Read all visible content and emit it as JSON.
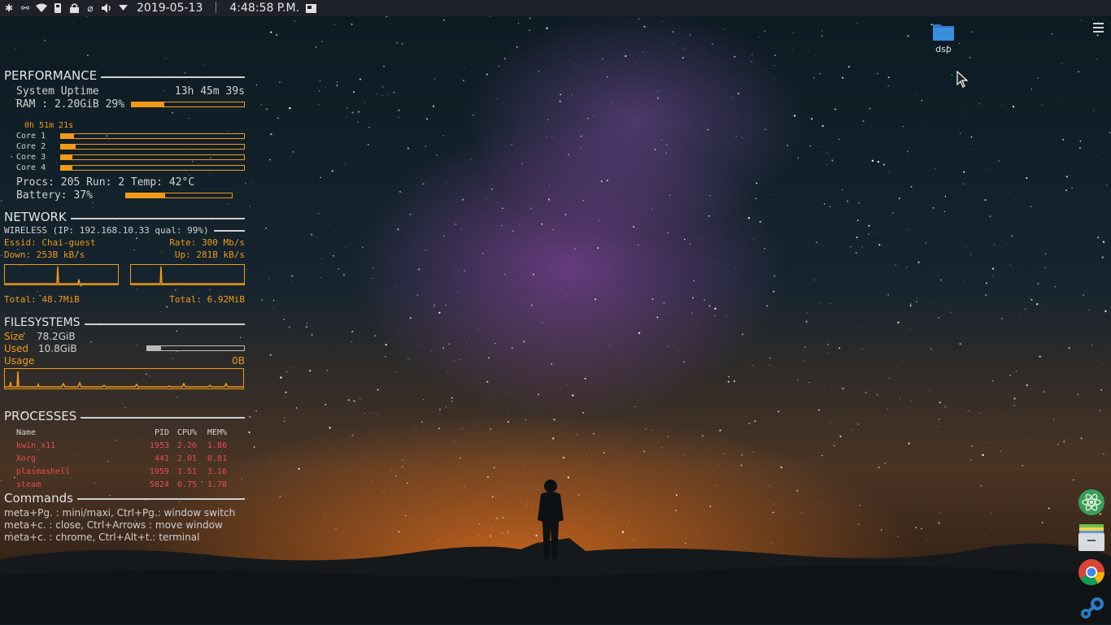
{
  "taskbar": {
    "tray_icons": [
      "settings-gear-icon",
      "network-plug-icon",
      "wifi-icon",
      "removable-drive-icon",
      "lock-icon",
      "clipboard-icon",
      "volume-icon",
      "expand-arrow-icon"
    ],
    "date": "2019-05-13",
    "time": "4:48:58 P.M."
  },
  "desktop": {
    "folder_label": "dsp",
    "folder_color": "#3b8de0"
  },
  "conky": {
    "accent": "#f19a1a",
    "performance": {
      "title": "PERFORMANCE",
      "uptime_label": "System Uptime",
      "uptime_value": "13h 45m 39s",
      "ram_label": "RAM : 2.20GiB 29%",
      "ram_percent": 29,
      "cores_time": "0h 51m 21s",
      "cores": [
        {
          "label": "Core 1",
          "percent": 7
        },
        {
          "label": "Core 2",
          "percent": 8
        },
        {
          "label": "Core 3",
          "percent": 6
        },
        {
          "label": "Core 4",
          "percent": 6
        }
      ],
      "procs_line": "Procs: 205  Run: 2 Temp: 42°C",
      "battery_label": "Battery: 37%",
      "battery_percent": 37
    },
    "network": {
      "title": "NETWORK",
      "wireless_line": "WIRELESS (IP: 192.168.10.33  qual: 99%)",
      "essid": "Essid: Chai-guest",
      "rate": "Rate: 300 Mb/s",
      "down": "Down: 253B kB/s",
      "up": "Up: 281B kB/s",
      "total_down": "Total: 48.7MiB",
      "total_up": "Total: 6.92MiB"
    },
    "filesystems": {
      "title": "FILESYSTEMS",
      "size_label": "Size",
      "size_value": "78.2GiB",
      "used_label": "Used",
      "used_value": "10.8GiB",
      "used_percent": 14,
      "usage_label": "Usage",
      "usage_value": "0B"
    },
    "processes": {
      "title": "PROCESSES",
      "headers": {
        "name": "Name",
        "pid": "PID",
        "cpu": "CPU%",
        "mem": "MEM%"
      },
      "rows": [
        {
          "name": "kwin_x11",
          "pid": "1953",
          "cpu": "2.26",
          "mem": "1.86"
        },
        {
          "name": "Xorg",
          "pid": "441",
          "cpu": "2.01",
          "mem": "0.81"
        },
        {
          "name": "plasmashell",
          "pid": "1959",
          "cpu": "1.51",
          "mem": "3.16"
        },
        {
          "name": "steam",
          "pid": "5824",
          "cpu": "0.75",
          "mem": "1.78"
        }
      ]
    },
    "commands": {
      "title": "Commands",
      "lines": [
        "meta+Pg. : mini/maxi, Ctrl+Pg.: window switch",
        "meta+c. : close, Ctrl+Arrows : move window",
        "meta+c. : chrome, Ctrl+Alt+t.: terminal"
      ]
    }
  },
  "dock": {
    "items": [
      "atom-icon",
      "file-manager-icon",
      "chrome-icon",
      "steam-icon"
    ]
  }
}
